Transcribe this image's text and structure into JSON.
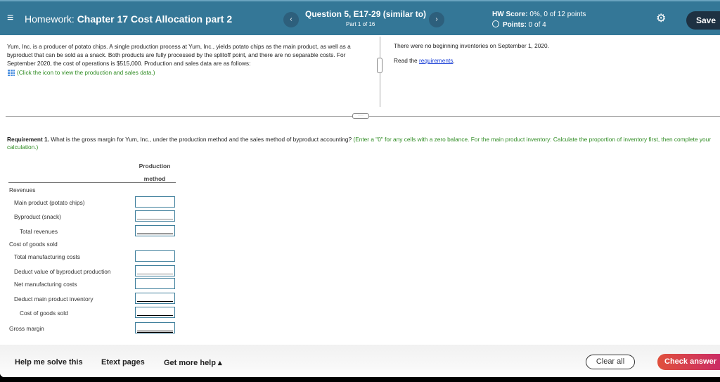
{
  "header": {
    "title_prefix": "Homework:",
    "title": "Chapter 17 Cost Allocation part 2",
    "question": "Question 5, E17-29 (similar to)",
    "part": "Part 1 of 16",
    "hw_score_label": "HW Score:",
    "hw_score": "0%, 0 of 12 points",
    "points_label": "Points:",
    "points": "0 of 4",
    "save": "Save",
    "prev": "‹",
    "next": "›",
    "menu": "≡",
    "gear": "⚙"
  },
  "intro": {
    "text": "Yum, Inc. is a producer of potato chips. A single production process at Yum, Inc., yields potato chips as the main product, as well as a byproduct that can be sold as a snack. Both products are fully processed by the splitoff point, and there are no separable costs. For September 2020, the cost of operations is $515,000. Production and sales data are as follows:",
    "data_link": "(Click the icon to view the production and sales data.)"
  },
  "right": {
    "inventories": "There were no beginning inventories on September 1, 2020.",
    "read_prefix": "Read the ",
    "requirements_link": "requirements",
    "read_suffix": "."
  },
  "requirement": {
    "label": "Requirement 1.",
    "question": "What is the gross margin for Yum, Inc., under the production method and the sales method of byproduct accounting?",
    "hint": "(Enter a \"0\" for any cells with a zero balance. For the main product inventory: Calculate the proportion of inventory first, then complete your calculation.)"
  },
  "table": {
    "column_header_1": "Production",
    "column_header_2": "method",
    "rows": [
      {
        "label": "Revenues"
      },
      {
        "label": "Main product (potato chips)",
        "value": ""
      },
      {
        "label": "Byproduct (snack)",
        "value": ""
      },
      {
        "label": "Total revenues",
        "value": ""
      },
      {
        "label": "Cost of goods sold"
      },
      {
        "label": "Total manufacturing costs",
        "value": ""
      },
      {
        "label": "Deduct value of byproduct production",
        "value": ""
      },
      {
        "label": "Net manufacturing costs",
        "value": ""
      },
      {
        "label": "Deduct main product inventory",
        "value": ""
      },
      {
        "label": "Cost of goods sold",
        "value": ""
      },
      {
        "label": "Gross margin",
        "value": ""
      }
    ]
  },
  "footer": {
    "help": "Help me solve this",
    "etext": "Etext pages",
    "more_help": "Get more help ▴",
    "clear": "Clear all",
    "check": "Check answer"
  }
}
